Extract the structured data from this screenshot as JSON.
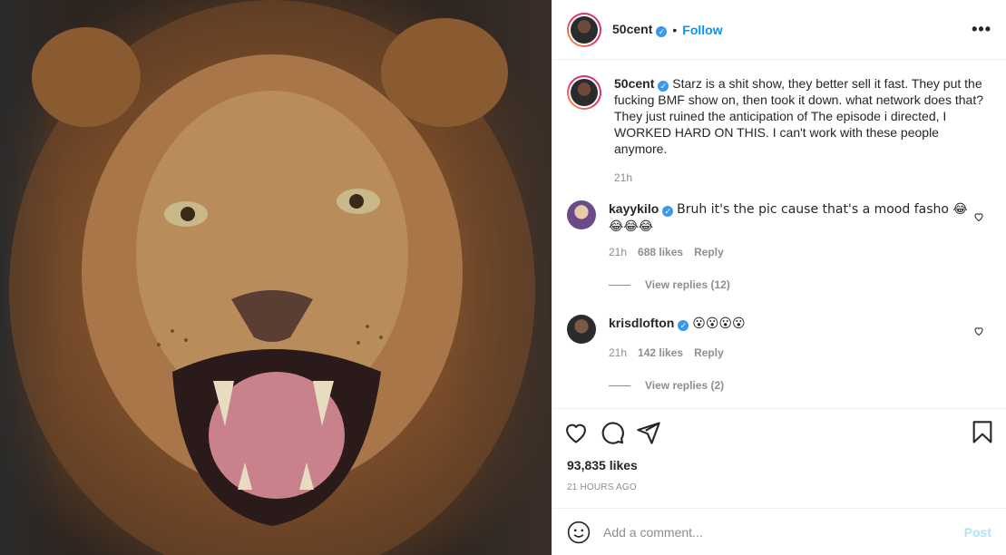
{
  "media": {
    "alt_subject": "lion-roaring-photo"
  },
  "header": {
    "username": "50cent",
    "separator": "•",
    "follow_label": "Follow",
    "more_label": "•••"
  },
  "caption": {
    "username": "50cent",
    "text": "Starz is a shit show, they better sell it fast. They put the fucking BMF show on, then took it down. what network does that? They just ruined the anticipation of The episode i directed, I WORKED HARD ON THIS. I can't work with these people anymore.",
    "time": "21h"
  },
  "comments": [
    {
      "username": "kayykilo",
      "text": "Bruh it's the pic cause that's a mood fasho 😂😂😂😂",
      "time": "21h",
      "likes": "688 likes",
      "reply_label": "Reply",
      "view_replies": "View replies (12)"
    },
    {
      "username": "krisdlofton",
      "text": "😮😮😮😮",
      "time": "21h",
      "likes": "142 likes",
      "reply_label": "Reply",
      "view_replies": "View replies (2)"
    }
  ],
  "likes_count": "93,835 likes",
  "time_ago": "21 HOURS AGO",
  "add_comment": {
    "placeholder": "Add a comment...",
    "post_label": "Post"
  },
  "colors": {
    "accent": "#0095f6",
    "verified": "#3897f0",
    "post_disabled": "#b2dffc",
    "muted": "#8e8e8e"
  },
  "icons": [
    "heart-icon",
    "comment-icon",
    "share-icon",
    "bookmark-icon",
    "smiley-icon",
    "verified-badge-icon",
    "more-icon"
  ]
}
